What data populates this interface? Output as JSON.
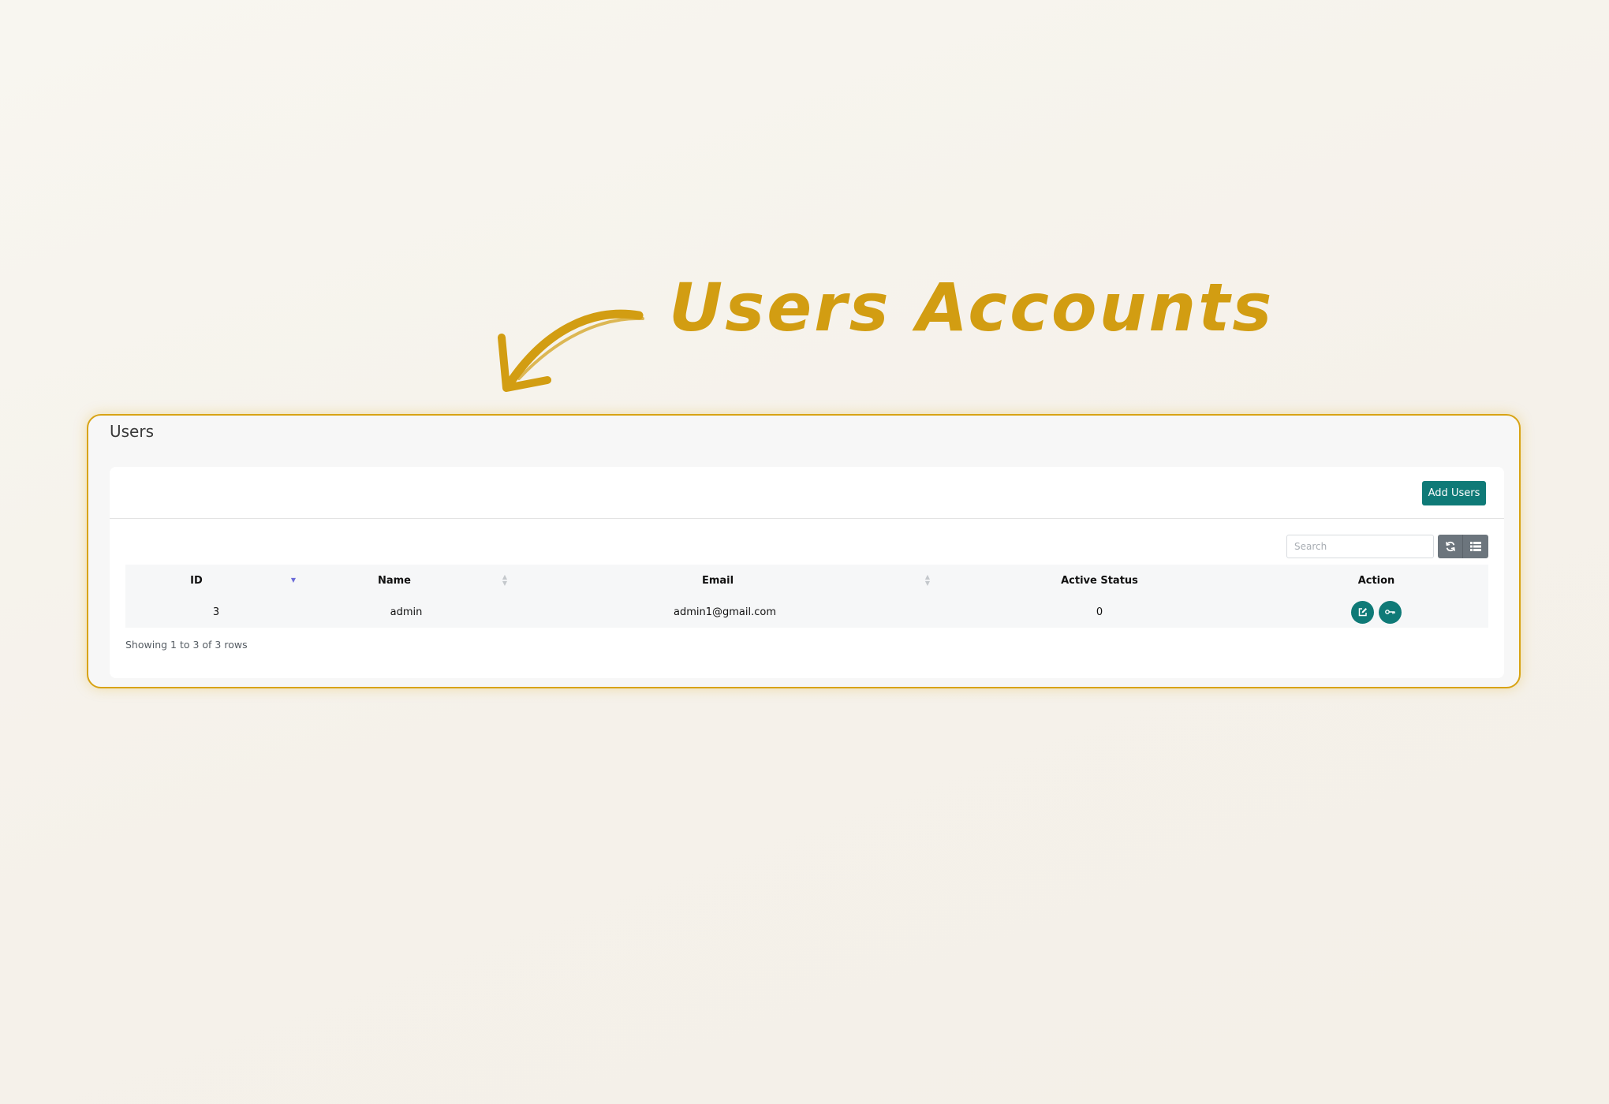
{
  "annotation": {
    "title": "Users Accounts"
  },
  "panel": {
    "title": "Users"
  },
  "toolbar": {
    "add_label": "Add Users",
    "search_placeholder": "Search",
    "refresh_icon": "refresh-icon",
    "columns_icon": "list-icon"
  },
  "table": {
    "columns": [
      "ID",
      "Name",
      "Email",
      "Active Status",
      "Action"
    ],
    "sorted_column": "ID",
    "rows": [
      {
        "id": "3",
        "name": "admin",
        "email": "admin1@gmail.com",
        "active_status": "0",
        "actions": [
          "edit-icon",
          "key-icon"
        ]
      }
    ]
  },
  "pagination": {
    "info": "Showing 1 to 3 of 3 rows"
  },
  "colors": {
    "accent": "#0f7a77",
    "highlight": "#d8a314",
    "annotation": "#d29d12",
    "secondary_button": "#6c757d"
  }
}
